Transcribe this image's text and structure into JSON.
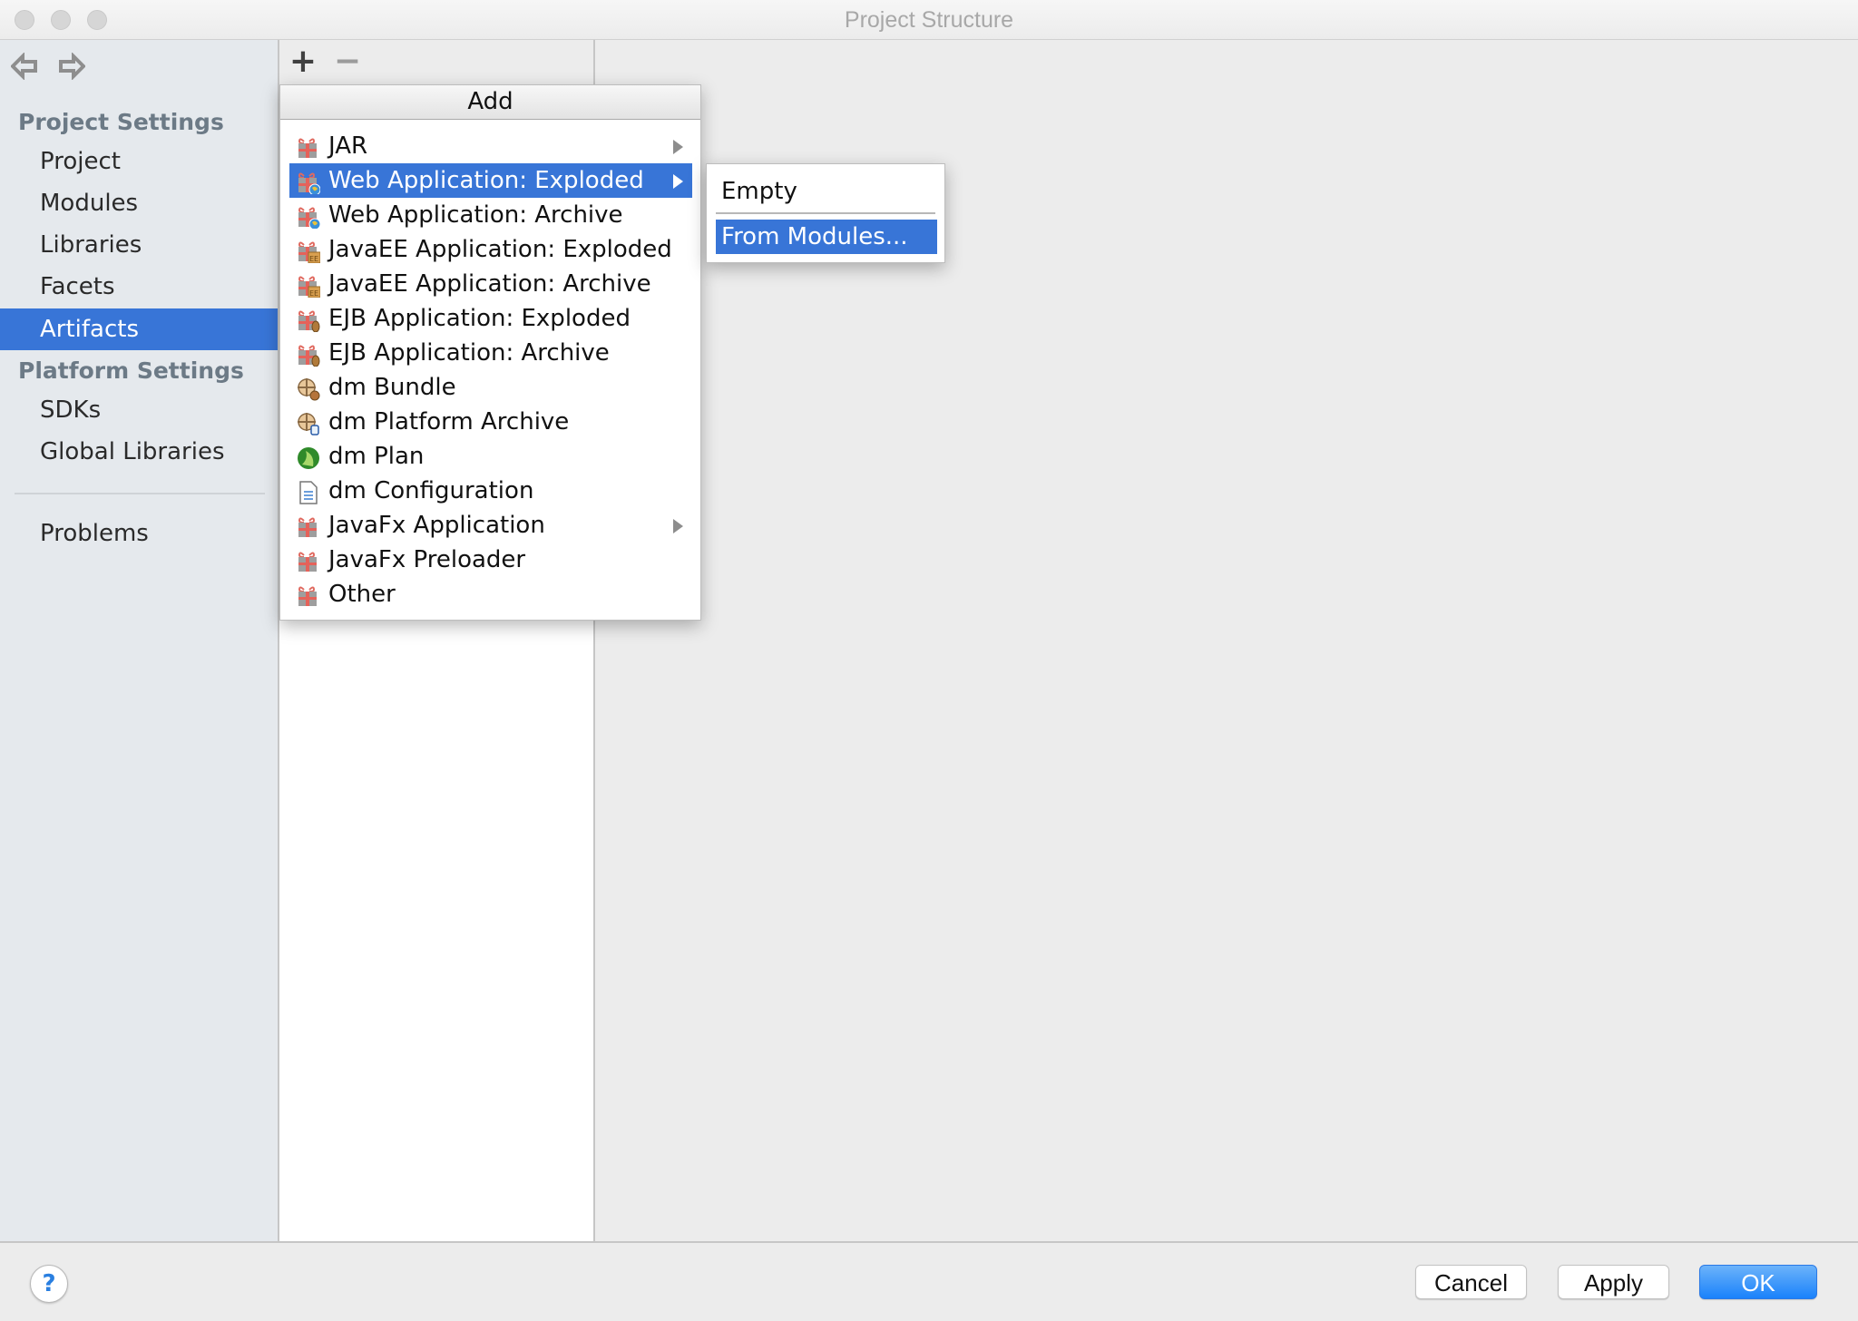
{
  "window": {
    "title": "Project Structure"
  },
  "nav": {
    "back": "back-arrow",
    "forward": "forward-arrow"
  },
  "sidebar": {
    "sections": [
      {
        "heading": "Project Settings",
        "items": [
          "Project",
          "Modules",
          "Libraries",
          "Facets",
          "Artifacts"
        ]
      },
      {
        "heading": "Platform Settings",
        "items": [
          "SDKs",
          "Global Libraries"
        ]
      }
    ],
    "extra_items": [
      "Problems"
    ],
    "selected": "Artifacts"
  },
  "toolbar": {
    "add_symbol": "+",
    "remove_symbol": "−"
  },
  "add_menu": {
    "title": "Add",
    "highlighted": "Web Application: Exploded",
    "items": [
      {
        "label": "JAR",
        "icon": "jar-gift-icon",
        "submenu": true
      },
      {
        "label": "Web Application: Exploded",
        "icon": "web-app-icon",
        "submenu": true
      },
      {
        "label": "Web Application: Archive",
        "icon": "web-app-icon",
        "submenu": false
      },
      {
        "label": "JavaEE Application: Exploded",
        "icon": "javaee-app-icon",
        "submenu": false
      },
      {
        "label": "JavaEE Application: Archive",
        "icon": "javaee-app-icon",
        "submenu": false
      },
      {
        "label": "EJB Application: Exploded",
        "icon": "ejb-app-icon",
        "submenu": false
      },
      {
        "label": "EJB Application: Archive",
        "icon": "ejb-app-icon",
        "submenu": false
      },
      {
        "label": "dm Bundle",
        "icon": "dm-bundle-icon",
        "submenu": false
      },
      {
        "label": "dm Platform Archive",
        "icon": "dm-platform-archive-icon",
        "submenu": false
      },
      {
        "label": "dm Plan",
        "icon": "dm-plan-icon",
        "submenu": false
      },
      {
        "label": "dm Configuration",
        "icon": "dm-configuration-icon",
        "submenu": false
      },
      {
        "label": "JavaFx Application",
        "icon": "javafx-gift-icon",
        "submenu": true
      },
      {
        "label": "JavaFx Preloader",
        "icon": "javafx-gift-icon",
        "submenu": false
      },
      {
        "label": "Other",
        "icon": "other-gift-icon",
        "submenu": false
      }
    ]
  },
  "sub_menu": {
    "items": [
      "Empty",
      "From Modules..."
    ],
    "highlighted": "From Modules..."
  },
  "footer": {
    "help": "?",
    "cancel": "Cancel",
    "apply": "Apply",
    "ok": "OK"
  },
  "colors": {
    "selection": "#3875d7",
    "primary_button": "#1a82fb"
  }
}
